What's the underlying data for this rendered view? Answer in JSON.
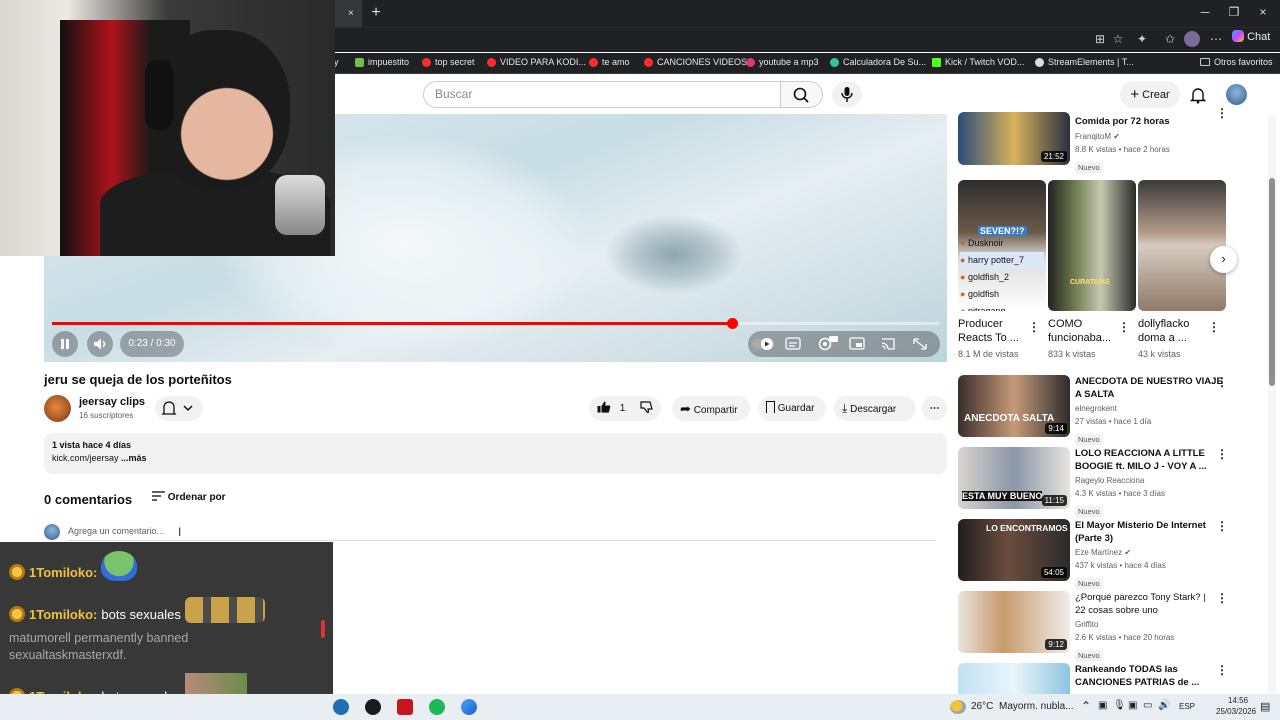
{
  "browser": {
    "tab_close": "×",
    "new_tab": "+",
    "win_controls": [
      "─",
      "❐",
      "×"
    ],
    "chat_label": "Chat",
    "bookmarks": [
      {
        "label": "impuestito",
        "color": "#6fbf4a"
      },
      {
        "label": "top secret",
        "color": "#ff2b2b"
      },
      {
        "label": "VIDEO PARA KODI...",
        "color": "#ff2b2b"
      },
      {
        "label": "te amo",
        "color": "#ff2b2b"
      },
      {
        "label": "CANCIONES VIDEOS",
        "color": "#ff2b2b"
      },
      {
        "label": "youtube a mp3",
        "color": "#e03a6a"
      },
      {
        "label": "Calculadora De Su...",
        "color": "#35c4a0"
      },
      {
        "label": "Kick / Twitch VOD...",
        "color": "#53fc18"
      },
      {
        "label": "StreamElements | T...",
        "color": "#dddddd"
      }
    ],
    "other_bookmarks": "Otros favoritos"
  },
  "youtube": {
    "search_placeholder": "Buscar",
    "create_label": "Crear"
  },
  "video": {
    "time": "0:23 / 0:30",
    "progress_fraction": 0.7667,
    "title": "jeru se queja de los porteñitos",
    "channel": "jeersay clips",
    "subscribers": "16 suscriptores",
    "likes": "1",
    "actions": {
      "share": "Compartir",
      "save": "Guardar",
      "download": "Descargar"
    },
    "description_line1": "1 vista  hace 4 días",
    "description_link": "kick.com/jeersay",
    "description_more": " ...más"
  },
  "comments": {
    "count_label": "0 comentarios",
    "sort_label": "Ordenar por",
    "add_placeholder": "Agrega un comentario..."
  },
  "sidebar": {
    "top_item": {
      "title": "Comida por 72 horas",
      "channel": "FranqitoM",
      "meta": "8.8 K vistas • hace 2 horas",
      "badge": "Nuevo",
      "duration": "21:52"
    },
    "shelf": [
      {
        "title": "Producer Reacts To ...",
        "meta": "8.1 M de vistas",
        "overlay_users": [
          "Dusknoir",
          "harry potter_7",
          "goldfish_2",
          "goldfish",
          "pitragang"
        ]
      },
      {
        "title": "COMO funcionaba...",
        "meta": "833 k vistas"
      },
      {
        "title": "dollyflacko doma a ...",
        "meta": "43 k vistas"
      }
    ],
    "items": [
      {
        "title1": "ANECDOTA DE NUESTRO VIAJE",
        "title2": "A SALTA",
        "channel": "elnegrokent",
        "meta": "27 vistas • hace 1 día",
        "badge": "Nuevo",
        "duration": "9:14",
        "thumb_text": "ANECDOTA SALTA"
      },
      {
        "title1": "LOLO REACCIONA A LITTLE",
        "title2": "BOOGIE ft. MILO J - VOY A ...",
        "channel": "Rageylo Reacciona",
        "meta": "4.3 K vistas • hace 3 días",
        "badge": "Nuevo",
        "duration": "11:15",
        "thumb_text": "ESTA MUY BUENO"
      },
      {
        "title1": "El Mayor Misterio De Internet",
        "title2": "(Parte 3)",
        "channel": "Eze Martínez",
        "meta": "437 k vistas • hace 4 días",
        "badge": "Nuevo",
        "duration": "54:05",
        "thumb_text": "LO ENCONTRAMOS"
      },
      {
        "title1": "¿Porqué parezco Tony Stark? |",
        "title2": "22 cosas sobre uno",
        "channel": "Griffito",
        "meta": "2.6 K vistas • hace 20 horas",
        "badge": "Nuevo",
        "duration": "9:12",
        "thumb_text": ""
      },
      {
        "title1": "Rankeando TODAS las",
        "title2": "CANCIONES PATRIAS de ...",
        "channel": "",
        "meta": "",
        "badge": "",
        "duration": "",
        "thumb_text": ""
      }
    ]
  },
  "chat": {
    "lines": [
      {
        "user": "1Tomiloko:",
        "text": ""
      },
      {
        "user": "1Tomiloko:",
        "text": "bots sexuales"
      },
      {
        "user": "1Tomiloko:",
        "text": "bots sexuales"
      }
    ],
    "mod_message_1": "matumorell permanently banned",
    "mod_message_2": "sexualtaskmasterxdf."
  },
  "taskbar": {
    "temperature": "26°C",
    "weather": "Mayorm. nubla...",
    "lang": "ESP",
    "time": "14:56",
    "date": "25/03/2026"
  }
}
